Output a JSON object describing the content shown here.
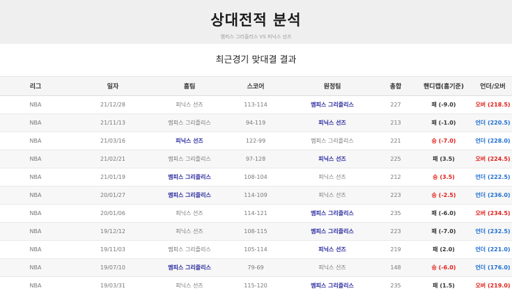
{
  "header": {
    "title": "상대전적 분석",
    "subtitle": "멤피스 그리즐리스 VS 피닉스 선즈"
  },
  "section_title": "최근경기 맞대결 결과",
  "columns": [
    "리그",
    "일자",
    "홈팀",
    "스코어",
    "원정팀",
    "총합",
    "핸디캡(홈기준)",
    "언더/오버"
  ],
  "rows": [
    {
      "league": "NBA",
      "date": "21/12/28",
      "home": "피닉스 선즈",
      "score": "113-114",
      "away": "멤피스 그리즐리스",
      "total": "227",
      "handicap": "패 (-9.0)",
      "ou": "오버 (218.5)",
      "winner": "away",
      "hc_result": "loss",
      "ou_type": "over"
    },
    {
      "league": "NBA",
      "date": "21/11/13",
      "home": "멤피스 그리즐리스",
      "score": "94-119",
      "away": "피닉스 선즈",
      "total": "213",
      "handicap": "패 (-1.0)",
      "ou": "언더 (220.5)",
      "winner": "away",
      "hc_result": "loss",
      "ou_type": "under"
    },
    {
      "league": "NBA",
      "date": "21/03/16",
      "home": "피닉스 선즈",
      "score": "122-99",
      "away": "멤피스 그리즐리스",
      "total": "221",
      "handicap": "승 (-7.0)",
      "ou": "언더 (228.0)",
      "winner": "home",
      "hc_result": "win",
      "ou_type": "under"
    },
    {
      "league": "NBA",
      "date": "21/02/21",
      "home": "멤피스 그리즐리스",
      "score": "97-128",
      "away": "피닉스 선즈",
      "total": "225",
      "handicap": "패 (3.5)",
      "ou": "오버 (224.5)",
      "winner": "away",
      "hc_result": "loss",
      "ou_type": "over"
    },
    {
      "league": "NBA",
      "date": "21/01/19",
      "home": "멤피스 그리즐리스",
      "score": "108-104",
      "away": "피닉스 선즈",
      "total": "212",
      "handicap": "승 (3.5)",
      "ou": "언더 (222.5)",
      "winner": "home",
      "hc_result": "win",
      "ou_type": "under"
    },
    {
      "league": "NBA",
      "date": "20/01/27",
      "home": "멤피스 그리즐리스",
      "score": "114-109",
      "away": "피닉스 선즈",
      "total": "223",
      "handicap": "승 (-2.5)",
      "ou": "언더 (236.0)",
      "winner": "home",
      "hc_result": "win",
      "ou_type": "under"
    },
    {
      "league": "NBA",
      "date": "20/01/06",
      "home": "피닉스 선즈",
      "score": "114-121",
      "away": "멤피스 그리즐리스",
      "total": "235",
      "handicap": "패 (-6.0)",
      "ou": "오버 (234.5)",
      "winner": "away",
      "hc_result": "loss",
      "ou_type": "over"
    },
    {
      "league": "NBA",
      "date": "19/12/12",
      "home": "피닉스 선즈",
      "score": "108-115",
      "away": "멤피스 그리즐리스",
      "total": "223",
      "handicap": "패 (-7.0)",
      "ou": "언더 (232.5)",
      "winner": "away",
      "hc_result": "loss",
      "ou_type": "under"
    },
    {
      "league": "NBA",
      "date": "19/11/03",
      "home": "멤피스 그리즐리스",
      "score": "105-114",
      "away": "피닉스 선즈",
      "total": "219",
      "handicap": "패 (2.0)",
      "ou": "언더 (221.0)",
      "winner": "away",
      "hc_result": "loss",
      "ou_type": "under"
    },
    {
      "league": "NBA",
      "date": "19/07/10",
      "home": "멤피스 그리즐리스",
      "score": "79-69",
      "away": "피닉스 선즈",
      "total": "148",
      "handicap": "승 (-6.0)",
      "ou": "언더 (176.0)",
      "winner": "home",
      "hc_result": "win",
      "ou_type": "under"
    },
    {
      "league": "NBA",
      "date": "19/03/31",
      "home": "피닉스 선즈",
      "score": "115-120",
      "away": "멤피스 그리즐리스",
      "total": "235",
      "handicap": "패 (1.5)",
      "ou": "오버 (219.0)",
      "winner": "away",
      "hc_result": "loss",
      "ou_type": "over"
    }
  ]
}
